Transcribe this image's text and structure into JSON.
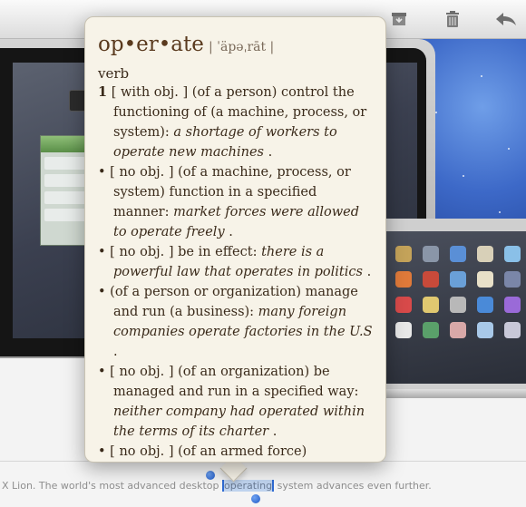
{
  "toolbar": {
    "buttons": [
      {
        "name": "archive",
        "icon": "archive-box-icon"
      },
      {
        "name": "trash",
        "icon": "trash-icon"
      },
      {
        "name": "reply",
        "icon": "reply-arrow-icon"
      }
    ]
  },
  "dictionary": {
    "headword": "op•er•ate",
    "pronunciation": "| ˈäpəˌrāt |",
    "part_of_speech": "verb",
    "senses": [
      {
        "number": "1",
        "bullet": "",
        "grammar": "[ with obj. ]",
        "definition": "(of a person) control the functioning of (a machine, process, or system):",
        "example": "a shortage of workers to operate new machines",
        "end": "."
      },
      {
        "number": "",
        "bullet": "•",
        "grammar": "[ no obj. ]",
        "definition": "(of a machine, process, or system) function in a specified manner:",
        "example": "market forces were allowed to operate freely",
        "end": "."
      },
      {
        "number": "",
        "bullet": "•",
        "grammar": "[ no obj. ]",
        "definition": "be in effect:",
        "example": "there is a powerful law that operates in politics",
        "end": "."
      },
      {
        "number": "",
        "bullet": "•",
        "grammar": "",
        "definition": "(of a person or organization) manage and run (a business):",
        "example": "many foreign companies operate factories in the U.S",
        "end": "."
      },
      {
        "number": "",
        "bullet": "•",
        "grammar": "[ no obj. ]",
        "definition": "(of an organization) be managed and run in a specified way:",
        "example": "neither company had operated within the terms of its charter",
        "end": "."
      },
      {
        "number": "",
        "bullet": "•",
        "grammar": "[ no obj. ]",
        "definition": "(of an armed force)",
        "example": "",
        "end": ""
      }
    ]
  },
  "caption": {
    "before": "X Lion. The world's most advanced desktop ",
    "selected": "operating",
    "after": " system advances even further."
  },
  "colors": {
    "highlight": "#bfd3ee",
    "selection_handle": "#2f6bd2",
    "popover_bg": "#f7f3e8"
  }
}
